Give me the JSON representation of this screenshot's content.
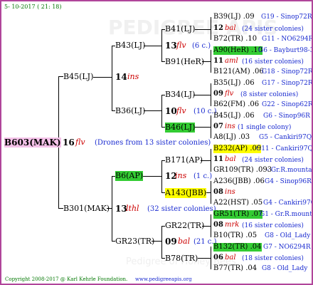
{
  "header": {
    "date": "5- 10-2017 ( 21: 18)"
  },
  "footer": {
    "copyright": "Copyright 2008-2017 @ Karl Kehrle Foundation.",
    "website": "www.pedigreeapis.org"
  },
  "watermark": {
    "line1": "PEDIGREE APIS",
    "line2": "Pedigree of Honey Bees"
  },
  "root": {
    "name": "B603(MAK)",
    "num": "16",
    "ins": "flv",
    "note": "(Drones from 13 sister colonies)"
  },
  "l1": [
    {
      "name": "B45(LJ)",
      "num": "14",
      "ins": "ins",
      "note": ""
    },
    {
      "name": "B301(MAK)",
      "num": "13",
      "ins": "lthl",
      "note": "(32 sister colonies)"
    }
  ],
  "l2": [
    {
      "name": "B43(LJ)",
      "num": "",
      "ins": "",
      "note": ""
    },
    {
      "name": "B36(LJ)",
      "num": "",
      "ins": "",
      "note": ""
    },
    {
      "name": "B6(AP)",
      "num": "",
      "ins": "",
      "note": ""
    },
    {
      "name": "GR23(TR)",
      "num": "09",
      "ins": "bal",
      "note": "(21 c.)"
    }
  ],
  "l3": [
    {
      "name": "B41(LJ)",
      "num": "13",
      "ins": "flv",
      "note": "(6 c.)"
    },
    {
      "name": "B91(HeR)",
      "num": "",
      "ins": "",
      "note": ""
    },
    {
      "name": "B34(LJ)",
      "num": "10",
      "ins": "flv",
      "note": "(10 c.)"
    },
    {
      "name": "B46(LJ)",
      "num": "",
      "ins": "",
      "note": ""
    },
    {
      "name": "B171(AP)",
      "num": "12",
      "ins": "ins",
      "note": "(1 c.)"
    },
    {
      "name": "A143(JBB)",
      "num": "",
      "ins": "",
      "note": ""
    },
    {
      "name": "GR22(TR)",
      "num": "",
      "ins": "",
      "note": ""
    },
    {
      "name": "B78(TR)",
      "num": "",
      "ins": "",
      "note": ""
    }
  ],
  "l4": [
    {
      "top": "B39(LJ) .09",
      "top_ref": "G19 - Sinop72R",
      "num": "12",
      "ins": "bal",
      "note": "(24 sister colonies)",
      "bot": "B72(TR) .10",
      "bot_ref": "G11 - NO6294R"
    },
    {
      "top": "A90(HeR) .10",
      "top_ref": "G6 - Bayburt98-3",
      "num": "11",
      "ins": "aml",
      "note": "(16 sister colonies)",
      "bot": "B121(AM) .06",
      "bot_ref": "G18 - Sinop72R"
    },
    {
      "top": "B35(LJ) .06",
      "top_ref": "G17 - Sinop72R",
      "num": "09",
      "ins": "flv",
      "note": "(8 sister colonies)",
      "bot": "B62(FM) .06",
      "bot_ref": "G22 - Sinop62R"
    },
    {
      "top": "B45(LJ) .06",
      "top_ref": "G6 - Sinop96R",
      "num": "07",
      "ins": "ins",
      "note": "(1 single colony)",
      "bot": "A8(LJ) .03",
      "bot_ref": "G5 - Cankiri97Q"
    },
    {
      "top": "B232(AP) .09",
      "top_ref": "G11 - Cankiri97Q",
      "num": "11",
      "ins": "bal",
      "note": "(24 sister colonies)",
      "bot": "GR109(TR) .093",
      "bot_ref": "- Gr.R.mounta"
    },
    {
      "top": "A236(JBB) .06",
      "top_ref": "G4 - Sinop96R",
      "num": "08",
      "ins": "ins",
      "note": "",
      "bot": "A22(HST) .05",
      "bot_ref": "G4 - Cankiri97Q"
    },
    {
      "top": "GR51(TR) .07",
      "top_ref": "G1 - Gr.R.mounta",
      "num": "08",
      "ins": "mrk",
      "note": "(16 sister colonies)",
      "bot": "B10(TR) .05",
      "bot_ref": "G8 - Old_Lady"
    },
    {
      "top": "B132(TR) .04",
      "top_ref": "G7 - NO6294R",
      "num": "06",
      "ins": "bal",
      "note": "(18 sister colonies)",
      "bot": "B77(TR) .04",
      "bot_ref": "G8 - Old_Lady"
    }
  ],
  "colors": {
    "border": "#b0459a",
    "green": "#33cc33",
    "yellow": "#ffff00",
    "pink": "#f5c2e9",
    "red": "#cc0000",
    "blue": "#1a2bd0",
    "header_green": "#007700"
  }
}
